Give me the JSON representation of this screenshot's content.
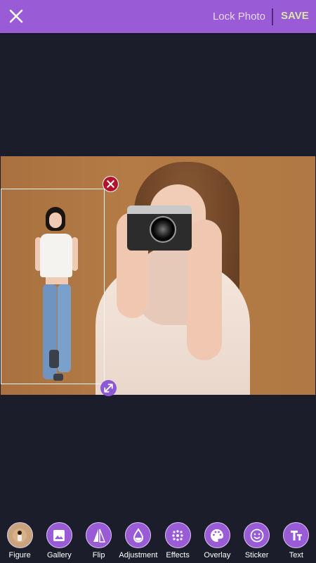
{
  "header": {
    "lock_photo": "Lock Photo",
    "save": "SAVE",
    "accent_color": "#9a5bd6"
  },
  "canvas": {
    "background_photo": "woman-holding-camera",
    "selected_figure": "standing-woman-white-top-jeans"
  },
  "toolbar": [
    {
      "id": "figure",
      "label": "Figure",
      "icon": "figure-thumbnail-icon"
    },
    {
      "id": "gallery",
      "label": "Gallery",
      "icon": "image-icon"
    },
    {
      "id": "flip",
      "label": "Flip",
      "icon": "flip-icon"
    },
    {
      "id": "adjustment",
      "label": "Adjustment",
      "icon": "drop-icon"
    },
    {
      "id": "effects",
      "label": "Effects",
      "icon": "dots-icon"
    },
    {
      "id": "overlay",
      "label": "Overlay",
      "icon": "palette-icon"
    },
    {
      "id": "sticker",
      "label": "Sticker",
      "icon": "smiley-icon"
    },
    {
      "id": "text",
      "label": "Text",
      "icon": "text-icon"
    }
  ]
}
